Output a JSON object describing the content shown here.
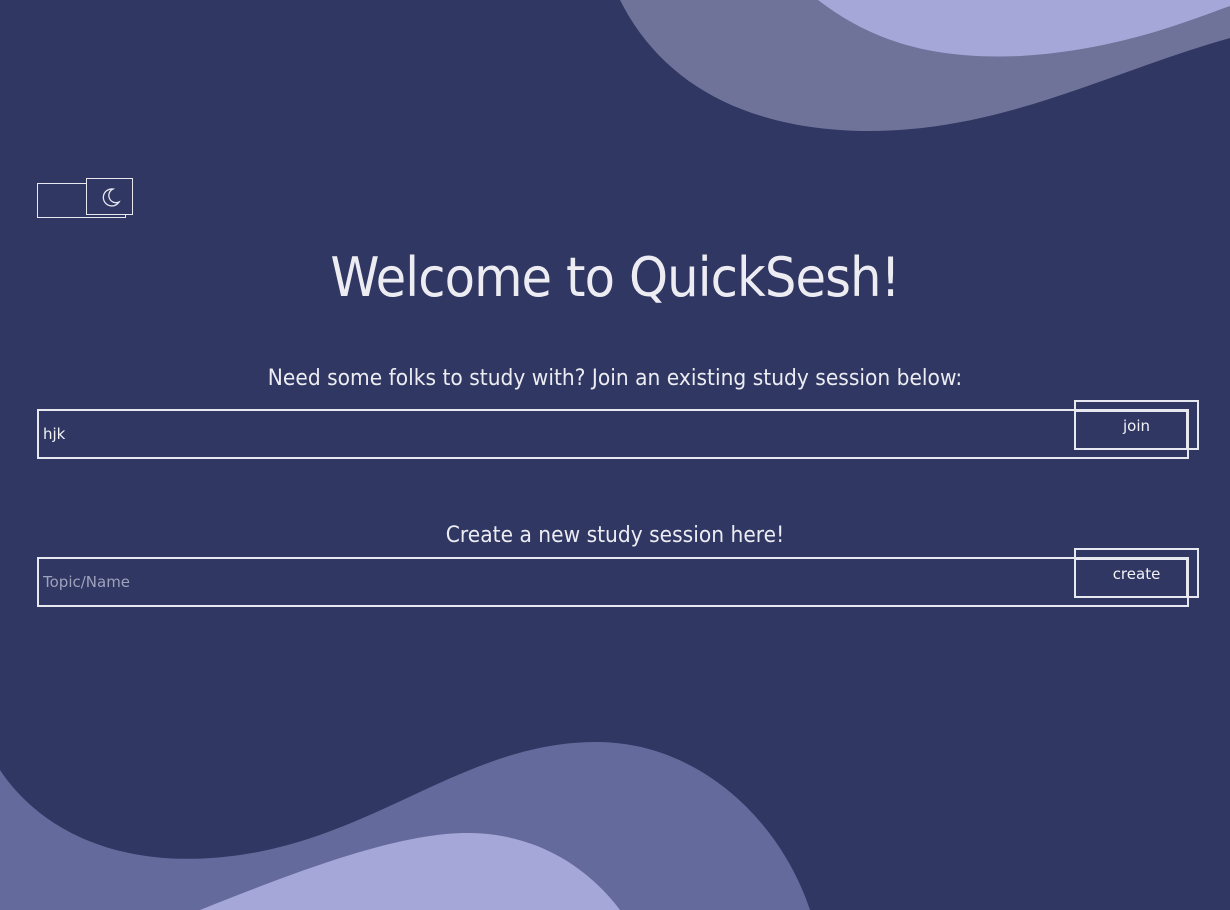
{
  "page": {
    "title": "Welcome to QuickSesh!"
  },
  "theme_toggle": {
    "icon": "moon-icon"
  },
  "join_section": {
    "prompt": "Need some folks to study with? Join an existing study session below:",
    "input_value": "hjk",
    "button_label": "join"
  },
  "create_section": {
    "prompt": "Create a new study session here!",
    "input_placeholder": "Topic/Name",
    "input_value": "",
    "button_label": "create"
  },
  "colors": {
    "background": "#2f3762",
    "wave_dark": "#6a6fa0",
    "wave_light": "#a6a7d9",
    "text": "#ececf2"
  }
}
